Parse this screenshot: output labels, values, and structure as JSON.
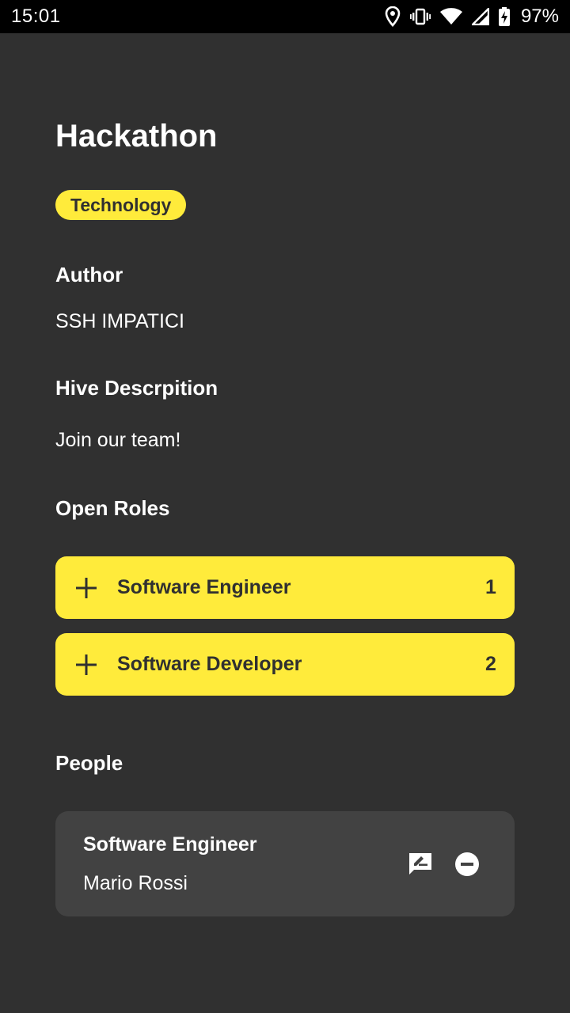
{
  "status_bar": {
    "time": "15:01",
    "battery": "97%",
    "icons": [
      "location-icon",
      "vibrate-icon",
      "wifi-icon",
      "signal-icon",
      "battery-charging-icon"
    ]
  },
  "page": {
    "title": "Hackathon",
    "category_chip": "Technology"
  },
  "author": {
    "label": "Author",
    "value": "SSH IMPATICI"
  },
  "description": {
    "label": "Hive Descrpition",
    "value": "Join our team!"
  },
  "open_roles": {
    "label": "Open Roles",
    "items": [
      {
        "icon": "plus-icon",
        "name": "Software Engineer",
        "count": "1"
      },
      {
        "icon": "plus-icon",
        "name": "Software Developer",
        "count": "2"
      }
    ]
  },
  "people": {
    "label": "People",
    "items": [
      {
        "role": "Software Engineer",
        "name": "Mario Rossi",
        "icons": [
          "chat-edit-icon",
          "remove-circle-icon"
        ]
      }
    ]
  },
  "colors": {
    "background": "#303030",
    "accent": "#ffeb3b",
    "card": "#424242",
    "status_bar": "#000000"
  }
}
